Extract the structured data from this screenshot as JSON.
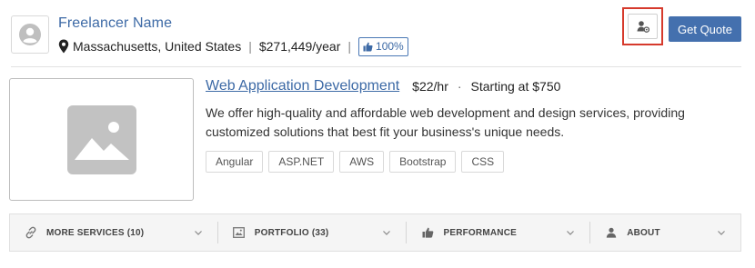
{
  "freelancer": {
    "name": "Freelancer Name",
    "location": "Massachusetts, United States",
    "separator": "|",
    "rate": "$271,449/year",
    "score": "100%"
  },
  "actions": {
    "follow_icon": "user-settings-icon",
    "quote_label": "Get Quote"
  },
  "service": {
    "title": "Web Application Development",
    "rate": "$22/hr",
    "dot": "·",
    "starting": "Starting at $750",
    "description": "We offer high-quality and affordable web development and design services, providing customized solutions that best fit your business's unique needs.",
    "tags": [
      "Angular",
      "ASP.NET",
      "AWS",
      "Bootstrap",
      "CSS"
    ],
    "image_icon": "image-placeholder-icon"
  },
  "tabs": [
    {
      "label": "MORE SERVICES (10)",
      "icon": "link-icon"
    },
    {
      "label": "PORTFOLIO (33)",
      "icon": "image-icon"
    },
    {
      "label": "PERFORMANCE",
      "icon": "thumbs-up-icon"
    },
    {
      "label": "ABOUT",
      "icon": "user-icon"
    }
  ],
  "colors": {
    "link": "#3d6aa6",
    "primary_button": "#4470ae",
    "highlight_border": "#d63a2c",
    "tab_bar_bg": "#f5f5f5"
  }
}
